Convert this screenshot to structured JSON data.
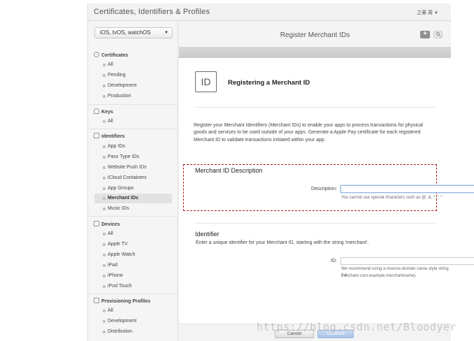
{
  "header": {
    "title": "Certificates, Identifiers & Profiles",
    "user": "之豪 周"
  },
  "sidebar": {
    "platform": "iOS, tvOS, watchOS",
    "sections": {
      "certificates": {
        "title": "Certificates",
        "items": [
          "All",
          "Pending",
          "Development",
          "Production"
        ]
      },
      "keys": {
        "title": "Keys",
        "items": [
          "All"
        ]
      },
      "identifiers": {
        "title": "Identifiers",
        "items": [
          "App IDs",
          "Pass Type IDs",
          "Website Push IDs",
          "iCloud Containers",
          "App Groups",
          "Merchant IDs",
          "Music IDs"
        ]
      },
      "devices": {
        "title": "Devices",
        "items": [
          "All",
          "Apple TV",
          "Apple Watch",
          "iPad",
          "iPhone",
          "iPod Touch"
        ]
      },
      "profiles": {
        "title": "Provisioning Profiles",
        "items": [
          "All",
          "Development",
          "Distribution"
        ]
      }
    },
    "active_item": "Merchant IDs"
  },
  "main": {
    "title": "Register Merchant IDs",
    "icon_text": "ID",
    "heading": "Registering a Merchant ID",
    "intro": "Register your Merchant Identifiers (Merchant IDs) to enable your apps to process transactions for physical goods and services to be used outside of your apps. Generate a Apple Pay certificate for each registered Merchant ID to validate transactions initiated within your app.",
    "description_section": {
      "title": "Merchant ID Description",
      "label": "Description:",
      "value": "",
      "hint": "You cannot use special characters such as @, &, *, ', \""
    },
    "identifier_section": {
      "title": "Identifier",
      "intro": "Enter a unique identifier for your Merchant ID, starting with the string 'merchant'.",
      "label": "ID:",
      "value": "",
      "hint_line1": "We recommend using a reverse-domain name style string (i.e.,",
      "hint_line2": "merchant.com.example.merchantname)."
    },
    "buttons": {
      "cancel": "Cancel",
      "continue": "Continue"
    }
  },
  "watermark": "https://blog.csdn.net/Bloodyer",
  "colors": {
    "highlight_border": "#a81c1c",
    "continue_button": "#a9c3e6",
    "add_button": "#8f8f8f"
  }
}
